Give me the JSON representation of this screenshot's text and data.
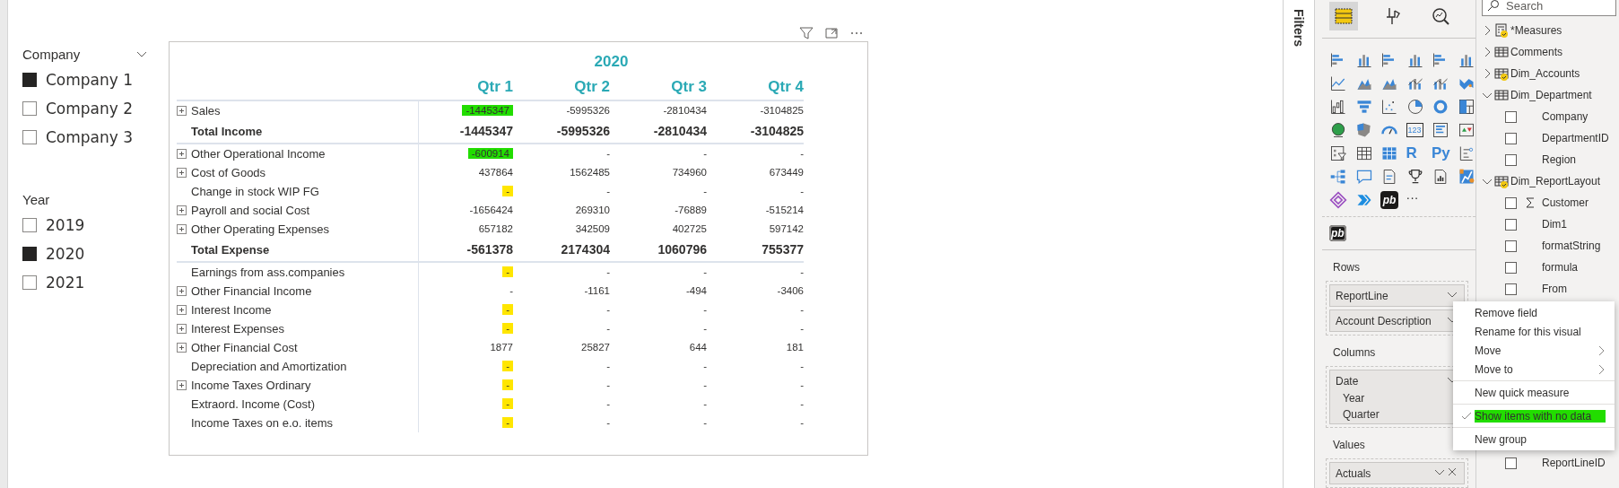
{
  "slicers": [
    {
      "title": "Company",
      "dropdown": true,
      "items": [
        {
          "label": "Company 1",
          "selected": true
        },
        {
          "label": "Company 2",
          "selected": false
        },
        {
          "label": "Company 3",
          "selected": false
        }
      ]
    },
    {
      "title": "Year",
      "dropdown": false,
      "items": [
        {
          "label": "2019",
          "selected": false
        },
        {
          "label": "2020",
          "selected": true
        },
        {
          "label": "2021",
          "selected": false
        }
      ]
    }
  ],
  "matrix": {
    "year": "2020",
    "columns": [
      "Qtr 1",
      "Qtr 2",
      "Qtr 3",
      "Qtr 4"
    ],
    "rows": [
      {
        "label": "Sales",
        "kind": "line",
        "expandable": true,
        "cells": [
          {
            "text": "-1445347",
            "color": "#22dd00"
          },
          {
            "text": "-5995326"
          },
          {
            "text": "-2810434"
          },
          {
            "text": "-3104825"
          }
        ]
      },
      {
        "label": "Total Income",
        "kind": "total",
        "expandable": false,
        "cells": [
          {
            "text": "-1445347"
          },
          {
            "text": "-5995326"
          },
          {
            "text": "-2810434"
          },
          {
            "text": "-3104825"
          }
        ]
      },
      {
        "label": "Other Operational Income",
        "kind": "line",
        "expandable": true,
        "cells": [
          {
            "text": "-600914",
            "color": "#22dd00"
          },
          {
            "text": "-"
          },
          {
            "text": "-"
          },
          {
            "text": "-"
          }
        ]
      },
      {
        "label": "Cost of Goods",
        "kind": "line",
        "expandable": true,
        "cells": [
          {
            "text": "437864"
          },
          {
            "text": "1562485"
          },
          {
            "text": "734960"
          },
          {
            "text": "673449"
          }
        ]
      },
      {
        "label": "Change in stock WIP FG",
        "kind": "line",
        "expandable": false,
        "cells": [
          {
            "text": "-",
            "color": "#ffe600"
          },
          {
            "text": "-"
          },
          {
            "text": "-"
          },
          {
            "text": "-"
          }
        ]
      },
      {
        "label": "Payroll and social Cost",
        "kind": "line",
        "expandable": true,
        "cells": [
          {
            "text": "-1656424"
          },
          {
            "text": "269310"
          },
          {
            "text": "-76889"
          },
          {
            "text": "-515214"
          }
        ]
      },
      {
        "label": "Other Operating Expenses",
        "kind": "line",
        "expandable": true,
        "cells": [
          {
            "text": "657182"
          },
          {
            "text": "342509"
          },
          {
            "text": "402725"
          },
          {
            "text": "597142"
          }
        ]
      },
      {
        "label": "Total Expense",
        "kind": "total",
        "expandable": false,
        "cells": [
          {
            "text": "-561378"
          },
          {
            "text": "2174304"
          },
          {
            "text": "1060796"
          },
          {
            "text": "755377"
          }
        ]
      },
      {
        "label": "Earnings from ass.companies",
        "kind": "line",
        "expandable": false,
        "cells": [
          {
            "text": "-",
            "color": "#ffe600"
          },
          {
            "text": "-"
          },
          {
            "text": "-"
          },
          {
            "text": "-"
          }
        ]
      },
      {
        "label": "Other Financial Income",
        "kind": "line",
        "expandable": true,
        "cells": [
          {
            "text": "-"
          },
          {
            "text": "-1161"
          },
          {
            "text": "-494"
          },
          {
            "text": "-3406"
          }
        ]
      },
      {
        "label": "Interest Income",
        "kind": "line",
        "expandable": true,
        "cells": [
          {
            "text": "-",
            "color": "#ffe600"
          },
          {
            "text": "-"
          },
          {
            "text": "-"
          },
          {
            "text": "-"
          }
        ]
      },
      {
        "label": "Interest Expenses",
        "kind": "line",
        "expandable": true,
        "cells": [
          {
            "text": "-",
            "color": "#ffe600"
          },
          {
            "text": "-"
          },
          {
            "text": "-"
          },
          {
            "text": "-"
          }
        ]
      },
      {
        "label": "Other Financial Cost",
        "kind": "line",
        "expandable": true,
        "cells": [
          {
            "text": "1877"
          },
          {
            "text": "25827"
          },
          {
            "text": "644"
          },
          {
            "text": "181"
          }
        ]
      },
      {
        "label": "Depreciation and Amortization",
        "kind": "line",
        "expandable": false,
        "cells": [
          {
            "text": "-",
            "color": "#ffe600"
          },
          {
            "text": "-"
          },
          {
            "text": "-"
          },
          {
            "text": "-"
          }
        ]
      },
      {
        "label": "Income Taxes Ordinary",
        "kind": "line",
        "expandable": true,
        "cells": [
          {
            "text": "-",
            "color": "#ffe600"
          },
          {
            "text": "-"
          },
          {
            "text": "-"
          },
          {
            "text": "-"
          }
        ]
      },
      {
        "label": "Extraord. Income (Cost)",
        "kind": "line",
        "expandable": false,
        "cells": [
          {
            "text": "-",
            "color": "#ffe600"
          },
          {
            "text": "-"
          },
          {
            "text": "-"
          },
          {
            "text": "-"
          }
        ]
      },
      {
        "label": "Income Taxes on e.o. items",
        "kind": "line",
        "expandable": false,
        "cells": [
          {
            "text": "-",
            "color": "#ffe600"
          },
          {
            "text": "-"
          },
          {
            "text": "-"
          },
          {
            "text": "-"
          }
        ]
      }
    ]
  },
  "filters_pane": {
    "title": "Filters"
  },
  "visualizations": {
    "tabs": [
      {
        "kind": "fields",
        "selected": true
      },
      {
        "kind": "format",
        "selected": false
      },
      {
        "kind": "analytics",
        "selected": false
      }
    ],
    "icons": [
      {
        "kind": "hbar"
      },
      {
        "kind": "column"
      },
      {
        "kind": "hbar"
      },
      {
        "kind": "column"
      },
      {
        "kind": "hbar"
      },
      {
        "kind": "column"
      },
      {
        "kind": "line"
      },
      {
        "kind": "area"
      },
      {
        "kind": "area"
      },
      {
        "kind": "combo"
      },
      {
        "kind": "combo"
      },
      {
        "kind": "ribbon"
      },
      {
        "kind": "waterfall"
      },
      {
        "kind": "funnel"
      },
      {
        "kind": "scatter"
      },
      {
        "kind": "pie"
      },
      {
        "kind": "donut"
      },
      {
        "kind": "treemap"
      },
      {
        "kind": "globe"
      },
      {
        "kind": "shape-map"
      },
      {
        "kind": "gauge"
      },
      {
        "kind": "card",
        "label": "123"
      },
      {
        "kind": "multirow"
      },
      {
        "kind": "kpi"
      },
      {
        "kind": "slicer"
      },
      {
        "kind": "table"
      },
      {
        "kind": "matrix"
      },
      {
        "kind": "letter",
        "label": "R"
      },
      {
        "kind": "letter",
        "label": "Py"
      },
      {
        "kind": "influencers"
      },
      {
        "kind": "decomposition"
      },
      {
        "kind": "speech"
      },
      {
        "kind": "document"
      },
      {
        "kind": "trophy"
      },
      {
        "kind": "report"
      },
      {
        "kind": "custom"
      },
      {
        "kind": "diamond"
      },
      {
        "kind": "chevrons"
      },
      {
        "kind": "logo",
        "label": "pb"
      },
      {
        "kind": "more",
        "label": "···"
      }
    ],
    "custom": [
      {
        "kind": "logo",
        "label": "pb"
      }
    ],
    "wells": [
      {
        "title": "Rows",
        "fields": [
          {
            "label": "ReportLine",
            "removable": false
          },
          {
            "label": "Account Description",
            "removable": false
          }
        ]
      },
      {
        "title": "Columns",
        "fields": [
          {
            "label": "Date",
            "removable": false,
            "children": [
              "Year",
              "Quarter"
            ]
          }
        ]
      },
      {
        "title": "Values",
        "fields": [
          {
            "label": "Actuals",
            "removable": true
          }
        ]
      }
    ]
  },
  "fields_pane": {
    "search": {
      "placeholder": "Search"
    },
    "tables": [
      {
        "label": "*Measures",
        "kind": "measures",
        "expanded": false,
        "in_use": true
      },
      {
        "label": "Comments",
        "kind": "table",
        "expanded": false,
        "in_use": false
      },
      {
        "label": "Dim_Accounts",
        "kind": "table",
        "expanded": false,
        "in_use": true
      },
      {
        "label": "Dim_Department",
        "kind": "table",
        "expanded": true,
        "in_use": false,
        "children": [
          {
            "label": "Company",
            "kind": "field",
            "checked": false
          },
          {
            "label": "DepartmentID",
            "kind": "field",
            "checked": false
          },
          {
            "label": "Region",
            "kind": "field",
            "checked": false
          }
        ]
      },
      {
        "label": "Dim_ReportLayout",
        "kind": "table",
        "expanded": true,
        "in_use": true,
        "children": [
          {
            "label": "Customer",
            "kind": "sum",
            "checked": false
          },
          {
            "label": "Dim1",
            "kind": "field",
            "checked": false
          },
          {
            "label": "formatString",
            "kind": "field",
            "checked": false
          },
          {
            "label": "formula",
            "kind": "field",
            "checked": false
          },
          {
            "label": "From",
            "kind": "field",
            "checked": false
          },
          {
            "label": "ReportLineID",
            "kind": "field",
            "checked": false
          }
        ]
      }
    ]
  },
  "context_menu": {
    "items": [
      {
        "label": "Remove field",
        "submenu": false,
        "checked": false,
        "separator_before": false
      },
      {
        "label": "Rename for this visual",
        "submenu": false,
        "checked": false,
        "separator_before": false
      },
      {
        "label": "Move",
        "submenu": true,
        "checked": false,
        "separator_before": false
      },
      {
        "label": "Move to",
        "submenu": true,
        "checked": false,
        "separator_before": false
      },
      {
        "label": "New quick measure",
        "submenu": false,
        "checked": false,
        "separator_before": true
      },
      {
        "label": "Show items with no data",
        "submenu": false,
        "checked": true,
        "separator_before": true,
        "color": "#22dd00"
      },
      {
        "label": "New group",
        "submenu": false,
        "checked": false,
        "separator_before": true
      }
    ]
  }
}
